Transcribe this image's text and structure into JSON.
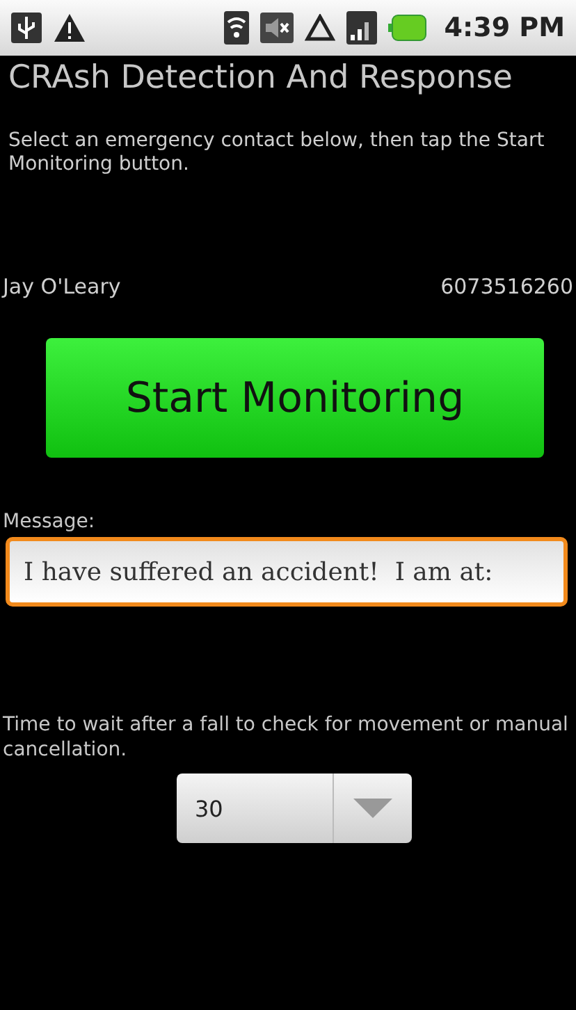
{
  "status_bar": {
    "time": "4:39 PM"
  },
  "title": "CRAsh Detection And Response",
  "instructions": "Select an emergency contact below, then tap the Start Monitoring button.",
  "contact": {
    "name": "Jay O'Leary",
    "phone": "6073516260"
  },
  "start_button": "Start Monitoring",
  "message": {
    "label": "Message:",
    "value": "I have suffered an accident!  I am at:",
    "focused": true
  },
  "wait": {
    "label": "Time to wait after a fall to check for movement or manual cancellation.",
    "value": "30"
  }
}
